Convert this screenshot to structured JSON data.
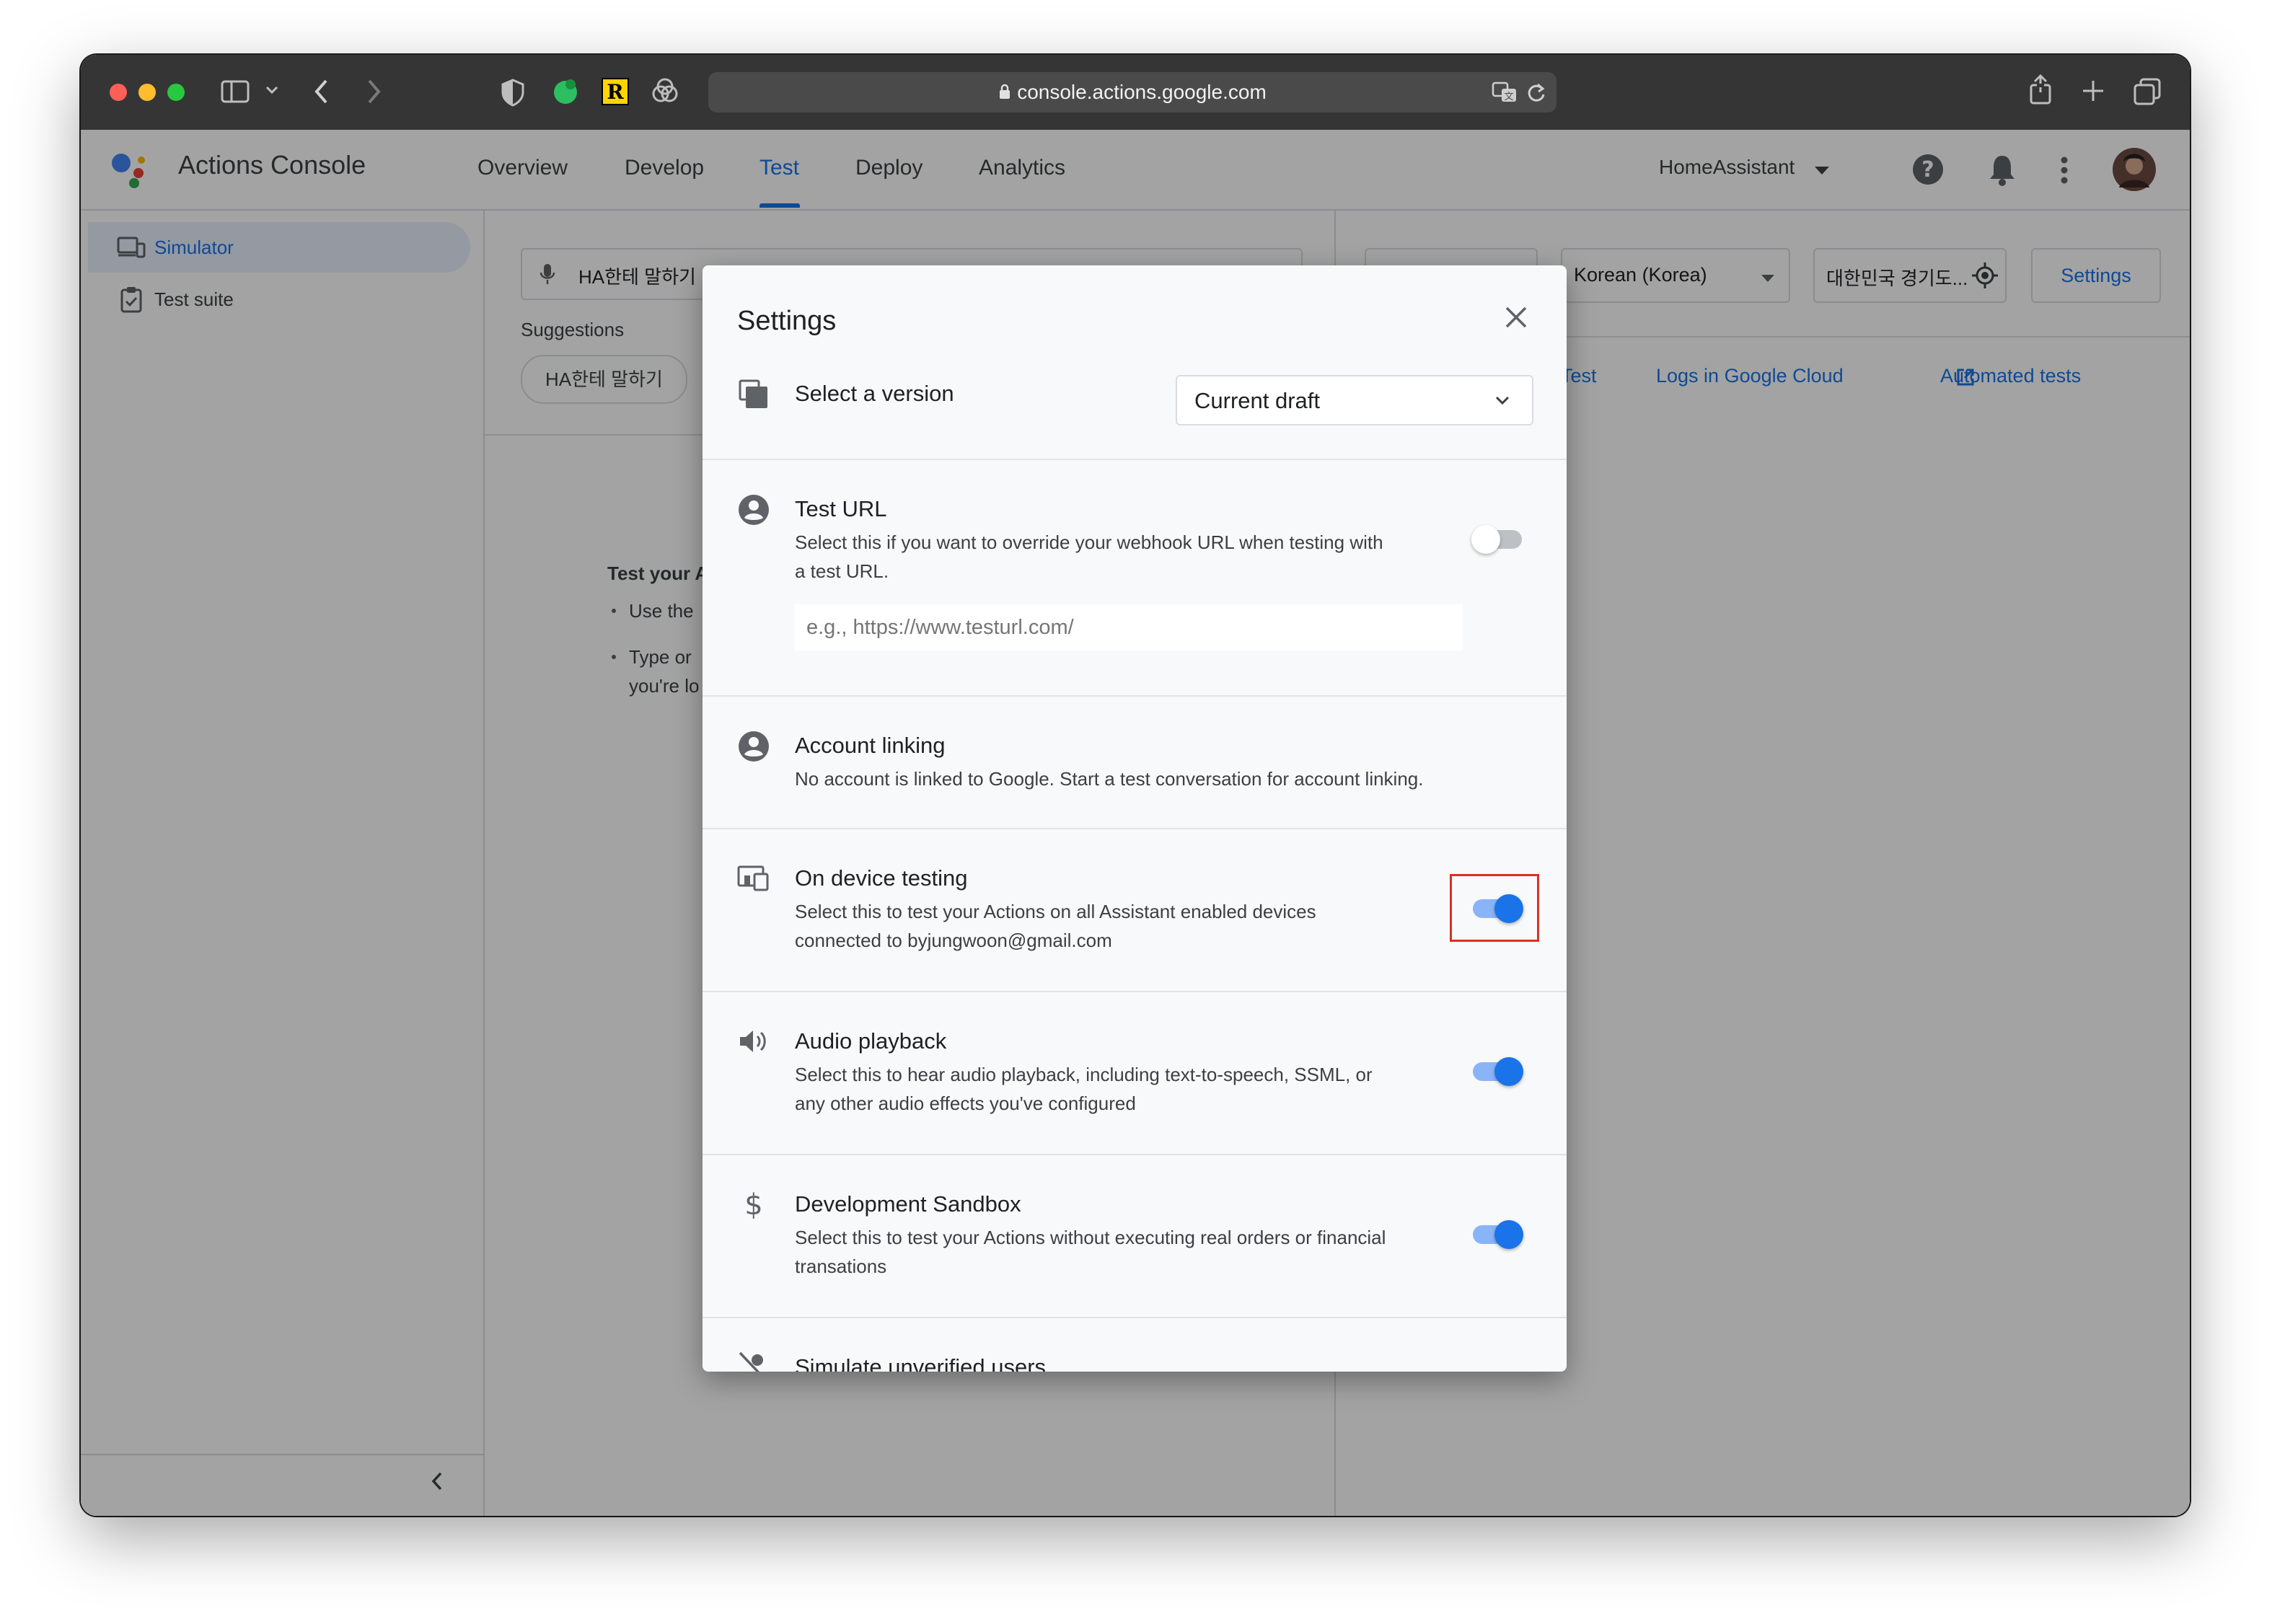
{
  "browser": {
    "url": "console.actions.google.com"
  },
  "app": {
    "title": "Actions Console",
    "nav": {
      "overview": "Overview",
      "develop": "Develop",
      "test": "Test",
      "deploy": "Deploy",
      "analytics": "Analytics"
    },
    "project": "HomeAssistant"
  },
  "sidebar": {
    "items": [
      {
        "label": "Simulator"
      },
      {
        "label": "Test suite"
      }
    ]
  },
  "simulator": {
    "input_value": "HA한테 말하기",
    "suggestions_label": "Suggestions",
    "suggestion_chip": "HA한테 말하기",
    "intro_partial": "Test your A",
    "bullet1_partial": "Use the",
    "bullet2_line1_partial": "Type or",
    "bullet2_line2_partial": "you're lo"
  },
  "right_panel": {
    "language": "Korean (Korea)",
    "location": "대한민국 경기도...",
    "settings_button": "Settings",
    "links": {
      "test": "Test",
      "logs": "Logs in Google Cloud",
      "automated": "Automated tests"
    }
  },
  "settings_dialog": {
    "title": "Settings",
    "version": {
      "label": "Select a version",
      "selected": "Current draft"
    },
    "test_url": {
      "title": "Test URL",
      "desc_line1": "Select this if you want to override your webhook URL when testing with",
      "desc_line2": "a test URL.",
      "placeholder": "e.g., https://www.testurl.com/",
      "enabled": false
    },
    "account_linking": {
      "title": "Account linking",
      "desc": "No account is linked to Google. Start a test conversation for account linking."
    },
    "on_device": {
      "title": "On device testing",
      "desc_line1": "Select this to test your Actions on all Assistant enabled devices",
      "desc_line2": "connected to byjungwoon@gmail.com",
      "enabled": true
    },
    "audio": {
      "title": "Audio playback",
      "desc_line1": "Select this to hear audio playback, including text-to-speech, SSML, or",
      "desc_line2": "any other audio effects you've configured",
      "enabled": true
    },
    "sandbox": {
      "title": "Development Sandbox",
      "desc_line1": "Select this to test your Actions without executing real orders or financial",
      "desc_line2": "transations",
      "enabled": true
    },
    "unverified": {
      "title": "Simulate unverified users"
    }
  },
  "colors": {
    "accent": "#1a73e8",
    "toggle_track_on": "#8ab4f8",
    "highlight_box": "#d93025",
    "chrome_bg": "#353535"
  }
}
